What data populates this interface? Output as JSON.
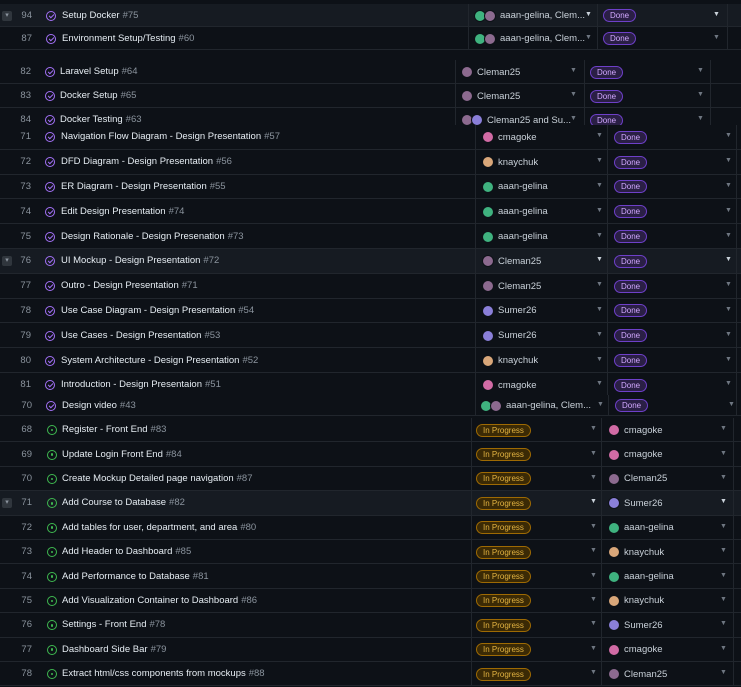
{
  "colors": {
    "background": "#0d1117",
    "row_border": "#21262d",
    "done_purple": "#a371f7",
    "in_progress_yellow": "#e3b341",
    "open_green": "#3fb950"
  },
  "icons": {
    "done": "check-circle-icon",
    "open": "issue-open-icon",
    "expand": "chevron-down-icon",
    "dropdown": "triangle-down-icon"
  },
  "top_rows": [
    {
      "num": "94",
      "title": "Setup Docker",
      "issue": "#75",
      "assignee": "aaan-gelina, Clem...",
      "status": "Done"
    },
    {
      "num": "87",
      "title": "Environment Setup/Testing",
      "issue": "#60",
      "assignee": "aaan-gelina, Clem...",
      "status": "Done"
    }
  ],
  "mid_rows": [
    {
      "num": "82",
      "title": "Laravel Setup",
      "issue": "#64",
      "assignee": "Cleman25",
      "status": "Done"
    },
    {
      "num": "83",
      "title": "Docker Setup",
      "issue": "#65",
      "assignee": "Cleman25",
      "status": "Done"
    },
    {
      "num": "84",
      "title": "Docker Testing",
      "issue": "#63",
      "assignee": "Cleman25 and Su...",
      "status": "Done"
    }
  ],
  "design_rows": [
    {
      "num": "71",
      "title": "Navigation Flow Diagram - Design Presentation",
      "issue": "#57",
      "assignee": "cmagoke",
      "status": "Done"
    },
    {
      "num": "72",
      "title": "DFD Diagram - Design Presentation",
      "issue": "#56",
      "assignee": "knaychuk",
      "status": "Done"
    },
    {
      "num": "73",
      "title": "ER Diagram - Design Presentation",
      "issue": "#55",
      "assignee": "aaan-gelina",
      "status": "Done"
    },
    {
      "num": "74",
      "title": "Edit Design Presentation",
      "issue": "#74",
      "assignee": "aaan-gelina",
      "status": "Done"
    },
    {
      "num": "75",
      "title": "Design Rationale - Design Presenation",
      "issue": "#73",
      "assignee": "aaan-gelina",
      "status": "Done"
    },
    {
      "num": "76",
      "title": "UI Mockup - Design Presentation",
      "issue": "#72",
      "assignee": "Cleman25",
      "status": "Done"
    },
    {
      "num": "77",
      "title": "Outro - Design Presentation",
      "issue": "#71",
      "assignee": "Cleman25",
      "status": "Done"
    },
    {
      "num": "78",
      "title": "Use Case Diagram - Design Presentation",
      "issue": "#54",
      "assignee": "Sumer26",
      "status": "Done"
    },
    {
      "num": "79",
      "title": "Use Cases - Design Presentation",
      "issue": "#53",
      "assignee": "Sumer26",
      "status": "Done"
    },
    {
      "num": "80",
      "title": "System Architecture - Design Presentation",
      "issue": "#52",
      "assignee": "knaychuk",
      "status": "Done"
    },
    {
      "num": "81",
      "title": "Introduction - Design Presentaion",
      "issue": "#51",
      "assignee": "cmagoke",
      "status": "Done"
    }
  ],
  "video_row": {
    "num": "70",
    "title": "Design video",
    "issue": "#43",
    "assignee": "aaan-gelina, Clem...",
    "status": "Done"
  },
  "progress_rows": [
    {
      "num": "68",
      "title": "Register - Front End",
      "issue": "#83",
      "status": "In Progress",
      "assignee": "cmagoke"
    },
    {
      "num": "69",
      "title": "Update Login Front End",
      "issue": "#84",
      "status": "In Progress",
      "assignee": "cmagoke"
    },
    {
      "num": "70",
      "title": "Create Mockup Detailed page navigation",
      "issue": "#87",
      "status": "In Progress",
      "assignee": "Cleman25"
    },
    {
      "num": "71",
      "title": "Add Course to Database",
      "issue": "#82",
      "status": "In Progress",
      "assignee": "Sumer26"
    },
    {
      "num": "72",
      "title": "Add tables for user, department, and area",
      "issue": "#80",
      "status": "In Progress",
      "assignee": "aaan-gelina"
    },
    {
      "num": "73",
      "title": "Add Header to Dashboard",
      "issue": "#85",
      "status": "In Progress",
      "assignee": "knaychuk"
    },
    {
      "num": "74",
      "title": "Add Performance to Database",
      "issue": "#81",
      "status": "In Progress",
      "assignee": "aaan-gelina"
    },
    {
      "num": "75",
      "title": "Add Visualization Container to Dashboard",
      "issue": "#86",
      "status": "In Progress",
      "assignee": "knaychuk"
    },
    {
      "num": "76",
      "title": "Settings - Front End",
      "issue": "#78",
      "status": "In Progress",
      "assignee": "Sumer26"
    },
    {
      "num": "77",
      "title": "Dashboard Side Bar",
      "issue": "#79",
      "status": "In Progress",
      "assignee": "cmagoke"
    },
    {
      "num": "78",
      "title": "Extract html/css components from mockups",
      "issue": "#88",
      "status": "In Progress",
      "assignee": "Cleman25"
    }
  ]
}
